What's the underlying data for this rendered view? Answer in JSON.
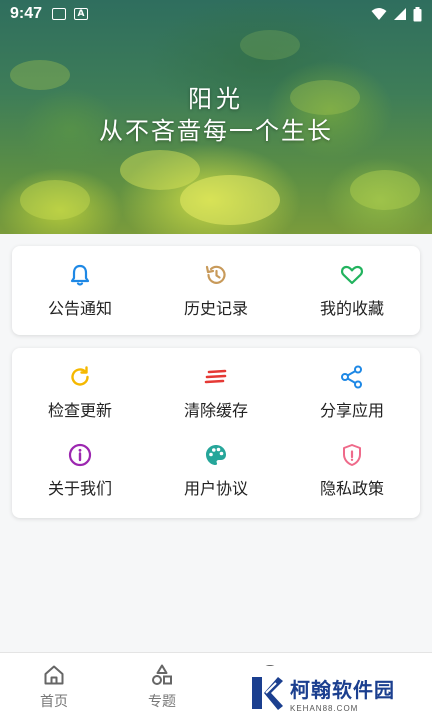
{
  "status_bar": {
    "time": "9:47"
  },
  "hero": {
    "line1": "阳光",
    "line2": "从不吝啬每一个生长"
  },
  "card1": {
    "items": [
      {
        "label": "公告通知",
        "icon": "bell-icon",
        "color": "#1e88e5"
      },
      {
        "label": "历史记录",
        "icon": "history-icon",
        "color": "#c89a5a"
      },
      {
        "label": "我的收藏",
        "icon": "heart-icon",
        "color": "#22b35e"
      }
    ]
  },
  "card2": {
    "items": [
      {
        "label": "检查更新",
        "icon": "refresh-icon",
        "color": "#f5b800"
      },
      {
        "label": "清除缓存",
        "icon": "clear-cache-icon",
        "color": "#e53935"
      },
      {
        "label": "分享应用",
        "icon": "share-icon",
        "color": "#1e88e5"
      },
      {
        "label": "关于我们",
        "icon": "info-icon",
        "color": "#9c27b0"
      },
      {
        "label": "用户协议",
        "icon": "palette-icon",
        "color": "#26a69a"
      },
      {
        "label": "隐私政策",
        "icon": "shield-icon",
        "color": "#ef6a8a"
      }
    ]
  },
  "bottom_nav": {
    "items": [
      {
        "label": "首页",
        "icon": "home-icon"
      },
      {
        "label": "专题",
        "icon": "shapes-icon"
      }
    ]
  },
  "watermark": {
    "title": "柯翰软件园",
    "subtitle": "KEHAN88.COM"
  }
}
